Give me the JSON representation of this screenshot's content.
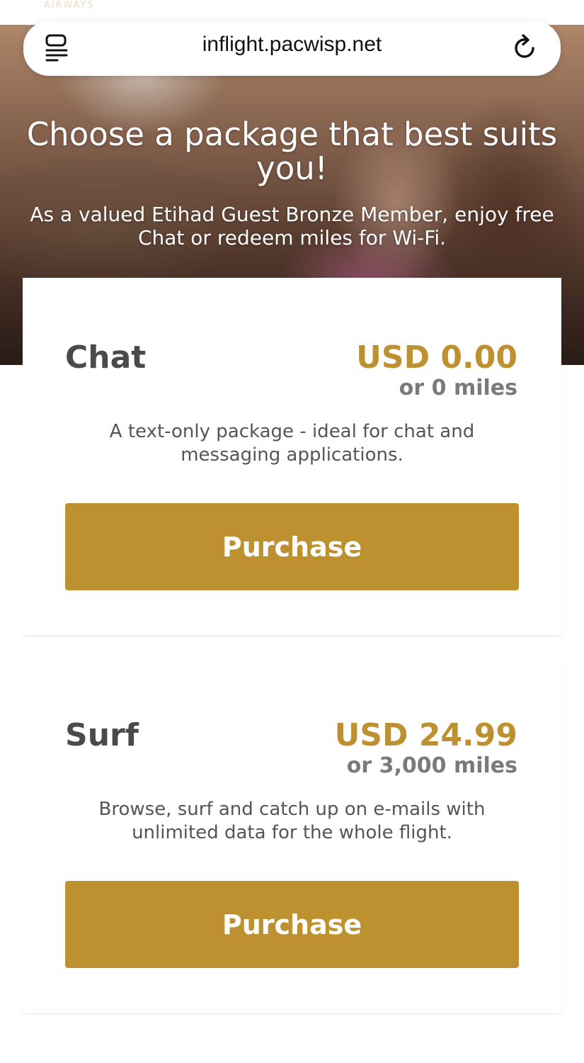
{
  "browser": {
    "url": "inflight.pacwisp.net"
  },
  "hero": {
    "faded_logo_text": "AIRWAYS",
    "title": "Choose a package that best suits you!",
    "subtitle": "As a valued Etihad Guest Bronze Member, enjoy free Chat or redeem miles for Wi-Fi."
  },
  "packages": [
    {
      "name": "Chat",
      "price": "USD 0.00",
      "miles": "or 0 miles",
      "description": "A text-only package - ideal for chat and messaging applications.",
      "button_label": "Purchase"
    },
    {
      "name": "Surf",
      "price": "USD 24.99",
      "miles": "or 3,000 miles",
      "description": "Browse, surf and catch up on e-mails with unlimited data for the whole flight.",
      "button_label": "Purchase"
    }
  ],
  "colors": {
    "accent_gold": "#bd9130",
    "heading_gray": "#4a4a4a",
    "miles_gray": "#7a7a7a"
  },
  "icons": {
    "reader": "reader-mode-icon",
    "reload": "reload-icon"
  }
}
